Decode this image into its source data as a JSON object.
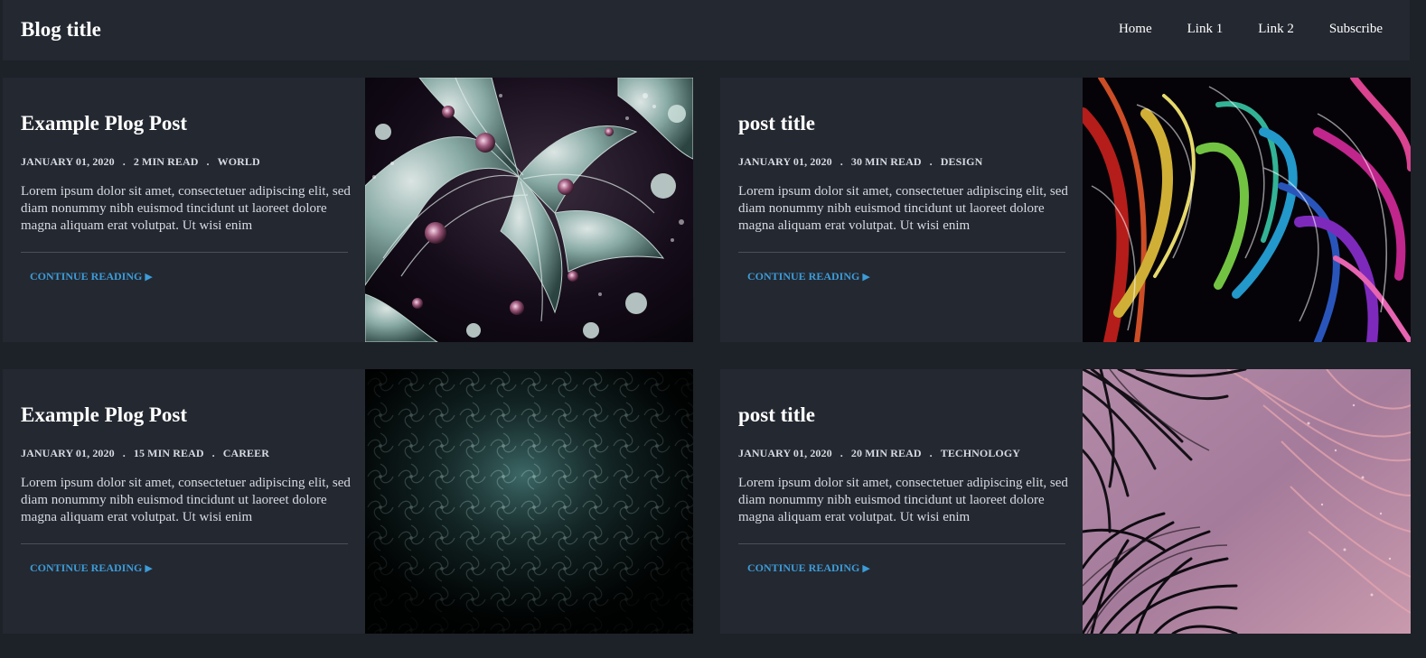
{
  "header": {
    "title": "Blog title",
    "nav": [
      "Home",
      "Link 1",
      "Link 2",
      "Subscribe"
    ]
  },
  "posts": [
    {
      "title": "Example Plog Post",
      "date": "JANUARY 01, 2020",
      "read_time": "2 MIN READ",
      "category": "WORLD",
      "excerpt": "Lorem ipsum dolor sit amet, consectetuer adipiscing elit, sed diam nonummy nibh euismod tincidunt ut laoreet dolore magna aliquam erat volutpat. Ut wisi enim",
      "cta": "CONTINUE READING",
      "image": "fractal-teal"
    },
    {
      "title": "post title",
      "date": "JANUARY 01, 2020",
      "read_time": "30 MIN READ",
      "category": "DESIGN",
      "excerpt": "Lorem ipsum dolor sit amet, consectetuer adipiscing elit, sed diam nonummy nibh euismod tincidunt ut laoreet dolore magna aliquam erat volutpat. Ut wisi enim",
      "cta": "CONTINUE READING",
      "image": "rainbow-smoke"
    },
    {
      "title": "Example Plog Post",
      "date": "JANUARY 01, 2020",
      "read_time": "15 MIN READ",
      "category": "CAREER",
      "excerpt": "Lorem ipsum dolor sit amet, consectetuer adipiscing elit, sed diam nonummy nibh euismod tincidunt ut laoreet dolore magna aliquam erat volutpat. Ut wisi enim",
      "cta": "CONTINUE READING",
      "image": "dark-damask"
    },
    {
      "title": "post title",
      "date": "JANUARY 01, 2020",
      "read_time": "20 MIN READ",
      "category": "TECHNOLOGY",
      "excerpt": "Lorem ipsum dolor sit amet, consectetuer adipiscing elit, sed diam nonummy nibh euismod tincidunt ut laoreet dolore magna aliquam erat volutpat. Ut wisi enim",
      "cta": "CONTINUE READING",
      "image": "pink-feathers"
    }
  ],
  "colors": {
    "background": "#1d2128",
    "card": "#242831",
    "link": "#3c9cd8",
    "meta": "#d7dae0"
  }
}
